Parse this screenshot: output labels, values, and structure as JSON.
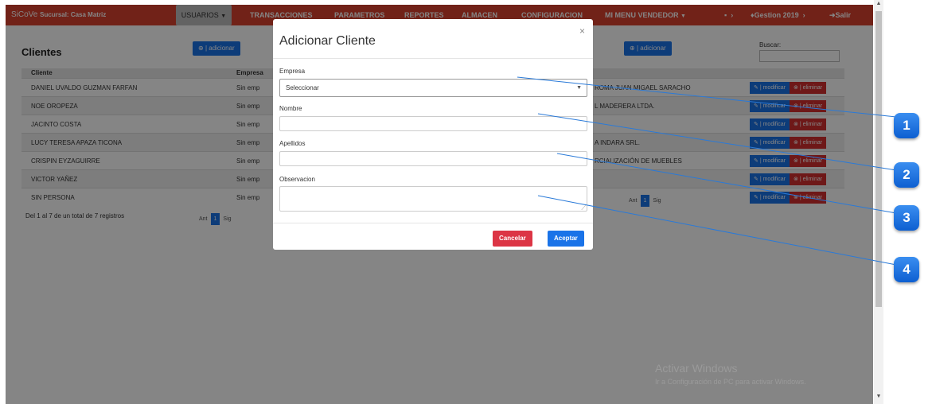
{
  "navbar": {
    "brand": "SiCoVe",
    "branch": "Sucursal: Casa Matriz",
    "usuarios": "USUARIOS",
    "transacciones": "TRANSACCIONES",
    "parametros": "PARAMETROS",
    "reportes": "REPORTES",
    "almacen": "ALMACEN",
    "configuracion": "CONFIGURACION",
    "mi_menu": "MI MENU VENDEDOR",
    "gestion": "Gestion 2019",
    "salir": "Salir"
  },
  "page": {
    "title": "Clientes",
    "add_label": "| adicionar",
    "search_label": "Buscar:"
  },
  "table": {
    "headers": {
      "cliente": "Cliente",
      "empresa": "Empresa"
    },
    "rows": [
      {
        "cliente": "DANIEL UVALDO GUZMAN FARFAN",
        "empresa": "Sin emp",
        "empresa_right": "ROMA JUAN MIGAEL SARACHO",
        "alt": false
      },
      {
        "cliente": "NOE OROPEZA",
        "empresa": "Sin emp",
        "empresa_right": "L MADERERA LTDA.",
        "alt": true
      },
      {
        "cliente": "JACINTO COSTA",
        "empresa": "Sin emp",
        "empresa_right": "",
        "alt": false
      },
      {
        "cliente": "LUCY TERESA APAZA TICONA",
        "empresa": "Sin emp",
        "empresa_right": "A INDARA SRL.",
        "alt": true
      },
      {
        "cliente": "CRISPIN EYZAGUIRRE",
        "empresa": "Sin emp",
        "empresa_right": "RCIALIZACIÓN DE MUEBLES",
        "alt": false
      },
      {
        "cliente": "VICTOR YAÑEZ",
        "empresa": "Sin emp",
        "empresa_right": "",
        "alt": true
      },
      {
        "cliente": "SIN PERSONA",
        "empresa": "Sin emp",
        "empresa_right": "",
        "alt": false
      }
    ],
    "modificar_label": "| modificar",
    "eliminar_label": "| eliminar"
  },
  "pagination": {
    "prev": "Ant",
    "current": "1",
    "next": "Sig"
  },
  "info": "Del 1 al 7 de un total de 7 registros",
  "modal": {
    "title": "Adicionar Cliente",
    "close": "×",
    "empresa_label": "Empresa",
    "empresa_value": "Seleccionar",
    "nombre_label": "Nombre",
    "apellidos_label": "Apellidos",
    "observacion_label": "Observacion",
    "cancel": "Cancelar",
    "accept": "Aceptar"
  },
  "markers": [
    "1",
    "2",
    "3",
    "4"
  ],
  "watermark": {
    "title": "Activar Windows",
    "subtitle": "Ir a Configuración de PC para activar Windows."
  },
  "colors": {
    "navbar": "#d9412f",
    "primary": "#1a73e8",
    "danger": "#dc3545",
    "marker": "#1a6fe0"
  }
}
